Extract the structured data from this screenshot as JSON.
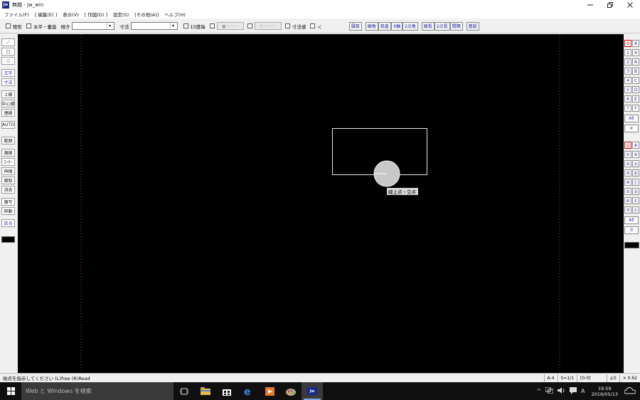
{
  "window": {
    "title": "無題 - jw_win",
    "app_icon_text": "Jw",
    "controls": [
      "minimize-icon",
      "restore-icon",
      "close-icon"
    ]
  },
  "menu": [
    "ファイル(F)",
    "[ 編集(E) ]",
    "表示(V)",
    "[ 作図(D) ]",
    "設定(S)",
    "[その他(A)]",
    "ヘルプ(H)"
  ],
  "toolbar": {
    "rect_label": "矩形",
    "hv_label": "水平・垂直",
    "slope_label": "傾き",
    "slope_value": "",
    "dim_label": "寸法",
    "dim_value": "",
    "deg15_label": "15度毎",
    "btn1_label": "●－－－",
    "btn2_label": "＜－－－",
    "dim_value_label": "寸法値",
    "lt_label": "＜",
    "blue_buttons_1": [
      "鉛直"
    ],
    "blue_buttons_1_pre": "鉛直",
    "group_a": [
      "鉛直"
    ],
    "group_a_labels": [
      "鉛直"
    ],
    "blue_groups": [
      [
        "鉛直"
      ]
    ],
    "buttons_a": [
      "鉛直"
    ],
    "btn_a1": "鉛直",
    "btn_kaiten": "鉛直",
    "buttons": {
      "g1": [
        "鉛直"
      ],
      "g2": [
        "線角",
        "鉛直",
        "X軸",
        "2点角"
      ],
      "g3": [
        "線長",
        "2点長",
        "間隔"
      ],
      "g4": [
        "基設"
      ]
    }
  },
  "left_palette": [
    {
      "id": "line",
      "label": "／"
    },
    {
      "id": "rect",
      "label": "□"
    },
    {
      "id": "circle",
      "label": "○"
    },
    {
      "id": "text",
      "label": "文字"
    },
    {
      "id": "dim",
      "label": "寸法"
    },
    {
      "id": "double-line",
      "label": "２線"
    },
    {
      "id": "center-line",
      "label": "中心線"
    },
    {
      "id": "continuous-line",
      "label": "連線"
    },
    {
      "id": "auto",
      "label": "AUTO"
    },
    {
      "id": "range",
      "label": "範囲"
    },
    {
      "id": "multi-line",
      "label": "複線"
    },
    {
      "id": "corner",
      "label": "ｺｰﾅｰ"
    },
    {
      "id": "stretch",
      "label": "伸縮"
    },
    {
      "id": "chamfer",
      "label": "面取"
    },
    {
      "id": "erase",
      "label": "消去"
    },
    {
      "id": "copy",
      "label": "複写"
    },
    {
      "id": "move",
      "label": "移動"
    },
    {
      "id": "undo",
      "label": "戻る"
    }
  ],
  "right_palette": {
    "layer_groups": [
      [
        "0",
        "8"
      ],
      [
        "1",
        "9"
      ],
      [
        "2",
        "A"
      ],
      [
        "3",
        "B"
      ],
      [
        "4",
        "C"
      ],
      [
        "5",
        "D"
      ],
      [
        "6",
        "E"
      ],
      [
        "7",
        "F"
      ]
    ],
    "layer_all": "All",
    "layer_x": "✕",
    "layers": [
      [
        "⓪",
        "⑧"
      ],
      [
        "①",
        "⑨"
      ],
      [
        "②",
        "Ⓐ"
      ],
      [
        "③",
        "Ⓑ"
      ],
      [
        "④",
        "Ⓒ"
      ],
      [
        "⑤",
        "Ⓓ"
      ],
      [
        "⑥",
        "Ⓔ"
      ],
      [
        "⑦",
        "Ⓕ"
      ]
    ],
    "layers_all": "All",
    "layers_zero": "0"
  },
  "canvas": {
    "cursor_tooltip": "線上点・交点"
  },
  "status": {
    "message": "始点を指示してください (L)free (R)Read",
    "paper": "A-4",
    "scale": "S=1/1",
    "layer": "[0-0]",
    "angle": "∠0",
    "zoom": "× 0.62"
  },
  "taskbar": {
    "search_placeholder": "Web と Windows を検索",
    "time": "19:59",
    "date": "2016/05/13",
    "ime": "A"
  }
}
